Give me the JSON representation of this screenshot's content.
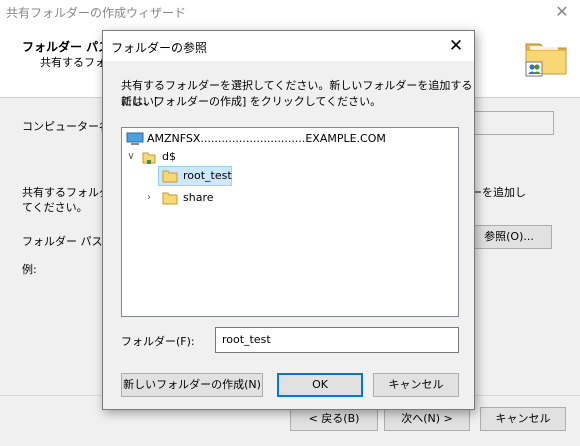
{
  "wizard": {
    "title": "共有フォルダーの作成ウィザード",
    "header_title": "フォルダー パス",
    "header_subtitle": "共有するフォル",
    "computer_label": "コンピューター名(C",
    "desc_left_1": "共有するフォルダー",
    "desc_left_2": "てください。",
    "desc_right": "ダーを追加し",
    "path_label": "フォルダー パス(F):",
    "example_label": "例:",
    "browse_button": "参照(O)...",
    "back_button": "< 戻る(B)",
    "next_button": "次へ(N) >",
    "cancel_button": "キャンセル"
  },
  "dialog": {
    "title": "フォルダーの参照",
    "instruction_line1": "共有するフォルダーを選択してください。新しいフォルダーを追加するには、[",
    "instruction_line2": "新しいフォルダーの作成] をクリックしてください。",
    "tree": {
      "root": "AMZNFSX..............................EXAMPLE.COM",
      "drive": "d$",
      "children": [
        "root_test",
        "share"
      ],
      "selected": "root_test"
    },
    "folder_label": "フォルダー(F):",
    "folder_value": "root_test",
    "new_folder_button": "新しいフォルダーの作成(N)",
    "ok_button": "OK",
    "cancel_button": "キャンセル"
  },
  "colors": {
    "selection_bg": "#cce8ff",
    "selection_border": "#99d1ff",
    "focus_border": "#0078d7",
    "folder_yellow": "#f8d775"
  }
}
